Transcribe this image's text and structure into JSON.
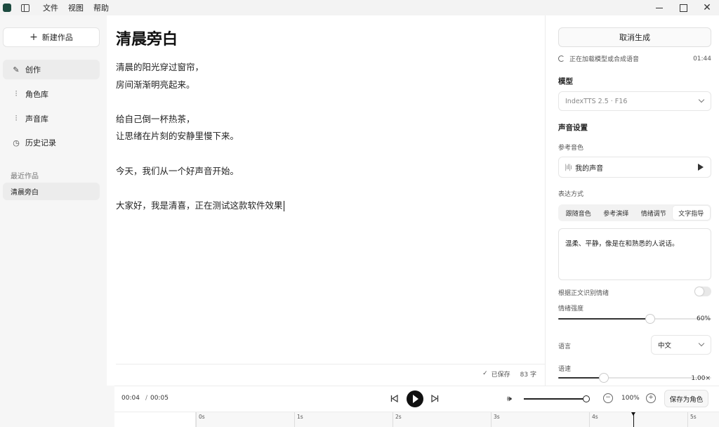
{
  "menu": [
    "文件",
    "视图",
    "帮助"
  ],
  "sidebar": {
    "new_label": "新建作品",
    "nav": [
      {
        "label": "创作",
        "icon": "pen-icon"
      },
      {
        "label": "角色库",
        "icon": "waveform-icon"
      },
      {
        "label": "声音库",
        "icon": "waveform-icon"
      },
      {
        "label": "历史记录",
        "icon": "clock-icon"
      }
    ],
    "recent_label": "最近作品",
    "recent_items": [
      "清晨旁白"
    ]
  },
  "editor": {
    "title": "清晨旁白",
    "lines": [
      "清晨的阳光穿过窗帘，",
      "房间渐渐明亮起来。",
      "",
      "给自己倒一杯热茶，",
      "让思绪在片刻的安静里慢下来。",
      "",
      "今天，我们从一个好声音开始。",
      "",
      "大家好，我是清喜，正在测试这款软件效果"
    ],
    "saved": "已保存",
    "char_count": "83 字"
  },
  "panel": {
    "cancel_label": "取消生成",
    "status_text": "正在加载模型或合成语音",
    "status_time": "01:44",
    "model_heading": "模型",
    "model_value": "IndexTTS 2.5 · F16",
    "voice_heading": "声音设置",
    "ref_label": "参考音色",
    "ref_value": "我的声音",
    "expr_label": "表达方式",
    "expr_tabs": [
      "跟随音色",
      "参考演绎",
      "情绪调节",
      "文字指导"
    ],
    "expr_active": 3,
    "prompt_text": "温柔、平静，像是在和熟悉的人说话。",
    "auto_emotion_label": "根据正文识别情绪",
    "auto_emotion_on": false,
    "intensity_label": "情绪强度",
    "intensity_value": "60%",
    "intensity_fraction": 0.6,
    "lang_label": "语言",
    "lang_value": "中文",
    "speed_label": "语速",
    "speed_value": "1.00×",
    "speed_fraction": 0.3
  },
  "player": {
    "current": "00:04",
    "total": "00:05",
    "volume_fraction": 1.0,
    "zoom": "100%",
    "save_role_label": "保存为角色"
  },
  "timeline": {
    "ticks": [
      "0s",
      "1s",
      "2s",
      "3s",
      "4s",
      "5s"
    ],
    "playhead_seconds": 4.45
  }
}
